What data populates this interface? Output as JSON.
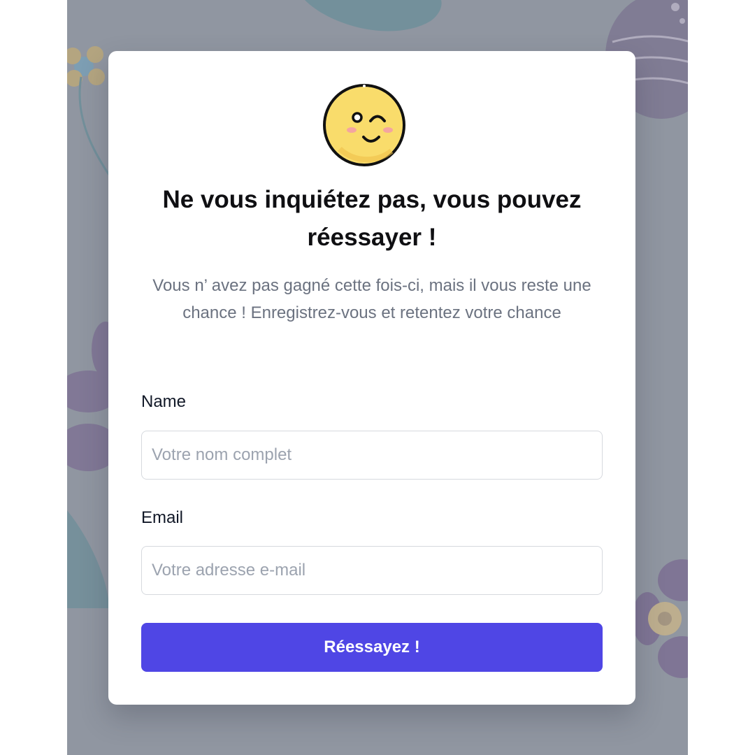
{
  "theme": {
    "backdrop_color": "#9096a1",
    "accent_color": "#4f46e5",
    "emoji_color": "#f9dc6b"
  },
  "modal": {
    "icon": "winking-face-icon",
    "title": "Ne vous inquiétez pas, vous pouvez réessayer !",
    "subtitle": "Vous n’ avez pas gagné cette fois-ci, mais il vous reste une chance ! Enregistrez-vous et retentez votre chance"
  },
  "form": {
    "name_label": "Name",
    "name_placeholder": "Votre nom complet",
    "name_value": "",
    "email_label": "Email",
    "email_placeholder": "Votre adresse e-mail",
    "email_value": "",
    "submit_label": "Réessayez !"
  }
}
